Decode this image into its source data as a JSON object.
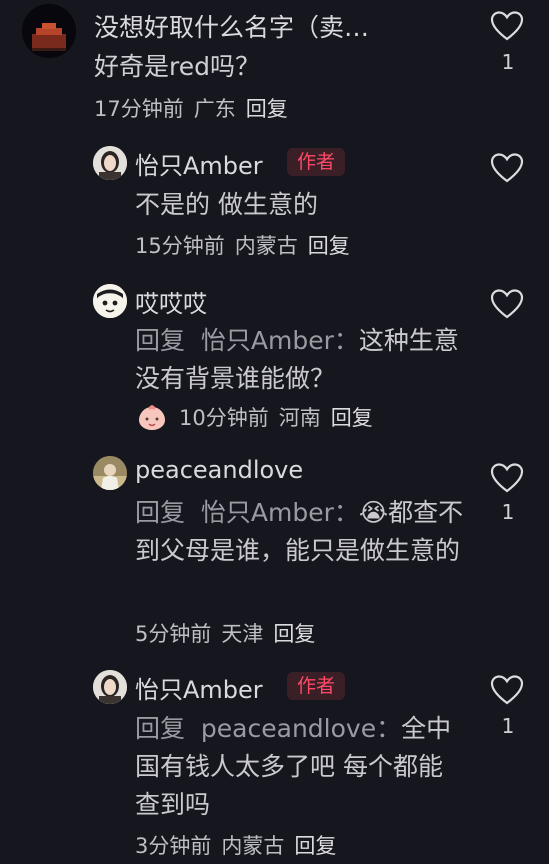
{
  "comments": [
    {
      "username": "没想好取什么名字（卖…",
      "text": "好奇是red吗？",
      "time": "17分钟前",
      "location": "广东",
      "reply_label": "回复",
      "like_count": "1"
    },
    {
      "username": "怡只Amber",
      "author_tag": "作者",
      "text": "不是的 做生意的",
      "time": "15分钟前",
      "location": "内蒙古",
      "reply_label": "回复"
    },
    {
      "username": "哎哎哎",
      "reply_prefix": "回复",
      "reply_target": "怡只Amber：",
      "text": "这种生意没有背景谁能做？",
      "time": "10分钟前",
      "location": "河南",
      "reply_label": "回复"
    },
    {
      "username": "peaceandlove",
      "reply_prefix": "回复",
      "reply_target": "怡只Amber：",
      "emoji": "😭",
      "text": "都查不到父母是谁，能只是做生意的",
      "time": "5分钟前",
      "location": "天津",
      "reply_label": "回复",
      "like_count": "1"
    },
    {
      "username": "怡只Amber",
      "author_tag": "作者",
      "reply_prefix": "回复",
      "reply_target": "peaceandlove：",
      "text": "全中国有钱人太多了吧 每个都能查到吗",
      "time": "3分钟前",
      "location": "内蒙古",
      "reply_label": "回复",
      "like_count": "1"
    }
  ],
  "colors": {
    "background": "#16161e",
    "author_tag": "#ff4a67",
    "author_tag_bg": "#3a1f27"
  },
  "icons": {
    "like": "heart-outline-icon",
    "time_badge": "peach-face-icon"
  }
}
